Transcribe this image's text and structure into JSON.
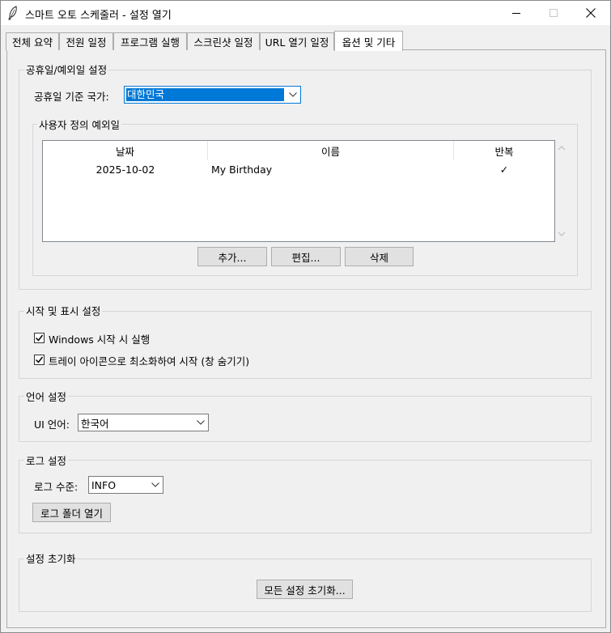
{
  "window": {
    "title": "스마트 오토 스케줄러 - 설정 열기"
  },
  "tabs": [
    {
      "label": "전체 요약"
    },
    {
      "label": "전원 일정"
    },
    {
      "label": "프로그램 실행"
    },
    {
      "label": "스크린샷 일정"
    },
    {
      "label": "URL 열기 일정"
    },
    {
      "label": "옵션 및 기타"
    }
  ],
  "holiday": {
    "group_title": "공휴일/예외일 설정",
    "country_label": "공휴일 기준 국가:",
    "country_value": "대한민국",
    "exceptions_title": "사용자 정의 예외일",
    "columns": [
      "날짜",
      "이름",
      "반복"
    ],
    "rows": [
      {
        "date": "2025-10-02",
        "name": "My Birthday",
        "repeat": "✓"
      }
    ],
    "add_label": "추가...",
    "edit_label": "편집...",
    "delete_label": "삭제"
  },
  "startup": {
    "group_title": "시작 및 표시 설정",
    "run_on_startup_label": "Windows 시작 시 실행",
    "run_on_startup_checked": true,
    "start_minimized_label": "트레이 아이콘으로 최소화하여 시작 (창 숨기기)",
    "start_minimized_checked": true
  },
  "language": {
    "group_title": "언어 설정",
    "ui_language_label": "UI 언어:",
    "ui_language_value": "한국어"
  },
  "log": {
    "group_title": "로그 설정",
    "level_label": "로그 수준:",
    "level_value": "INFO",
    "open_folder_label": "로그 폴더 열기"
  },
  "reset": {
    "group_title": "설정 초기화",
    "reset_all_label": "모든 설정 초기화..."
  },
  "colors": {
    "accent": "#0078d7",
    "window_bg": "#f0f0f0",
    "button_bg": "#e1e1e1"
  }
}
